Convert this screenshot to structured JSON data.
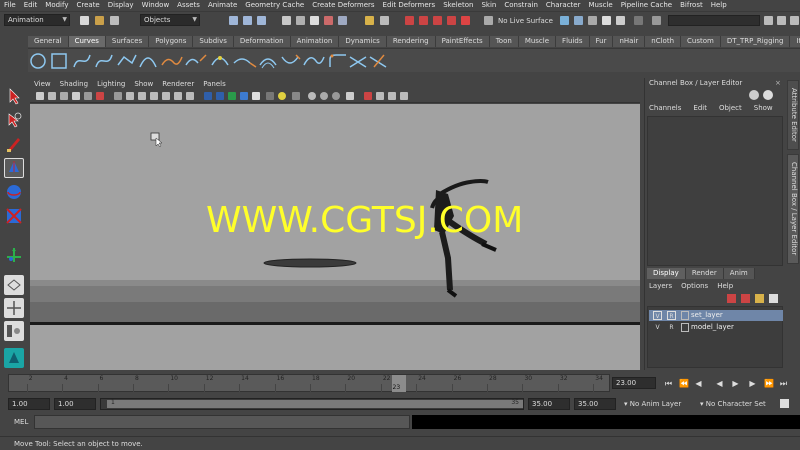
{
  "menubar": [
    "File",
    "Edit",
    "Modify",
    "Create",
    "Display",
    "Window",
    "Assets",
    "Animate",
    "Geometry Cache",
    "Create Deformers",
    "Edit Deformers",
    "Skeleton",
    "Skin",
    "Constrain",
    "Character",
    "Muscle",
    "Pipeline Cache",
    "Bifrost",
    "Help"
  ],
  "statusline": {
    "menuset": "Animation",
    "selection_mode": "Objects",
    "live_surface": "No Live Surface"
  },
  "shelf_tabs": [
    "General",
    "Curves",
    "Surfaces",
    "Polygons",
    "Subdivs",
    "Deformation",
    "Animation",
    "Dynamics",
    "Rendering",
    "PaintEffects",
    "Toon",
    "Muscle",
    "Fluids",
    "Fur",
    "nHair",
    "nCloth",
    "Custom",
    "DT_TRP_Rigging",
    "Item"
  ],
  "shelf_active_tab": "Curves",
  "viewport": {
    "menu": [
      "View",
      "Shading",
      "Lighting",
      "Show",
      "Renderer",
      "Panels"
    ],
    "watermark": "WWW.CGTSJ.COM"
  },
  "channel_box": {
    "title": "Channel Box / Layer Editor",
    "menu": [
      "Channels",
      "Edit",
      "Object",
      "Show"
    ]
  },
  "layer_editor": {
    "tabs": [
      "Display",
      "Render",
      "Anim"
    ],
    "active_tab": "Display",
    "menu": [
      "Layers",
      "Options",
      "Help"
    ],
    "layers": [
      {
        "v": "V",
        "r": "R",
        "name": "set_layer",
        "selected": true
      },
      {
        "v": "V",
        "r": "R",
        "name": "model_layer",
        "selected": false
      }
    ]
  },
  "side_tabs": [
    "Attribute Editor",
    "Channel Box / Layer Editor"
  ],
  "timeline": {
    "ticks": [
      "2",
      "4",
      "6",
      "8",
      "10",
      "12",
      "14",
      "16",
      "18",
      "20",
      "22",
      "24",
      "26",
      "28",
      "30",
      "32",
      "34"
    ],
    "current_frame": "23",
    "current_frame_field": "23.00"
  },
  "range": {
    "start": "1.00",
    "anim_start": "1.00",
    "range_start_label": "1",
    "range_end_label": "35",
    "anim_end": "35.00",
    "end": "35.00",
    "anim_layer": "No Anim Layer",
    "character_set": "No Character Set"
  },
  "command_line": {
    "label": "MEL"
  },
  "help_line": "Move Tool: Select an object to move.",
  "colors": {
    "accent": "#ffff2a",
    "selected_layer": "#6f86a8",
    "viewport_bg": "#a2a2a2"
  }
}
